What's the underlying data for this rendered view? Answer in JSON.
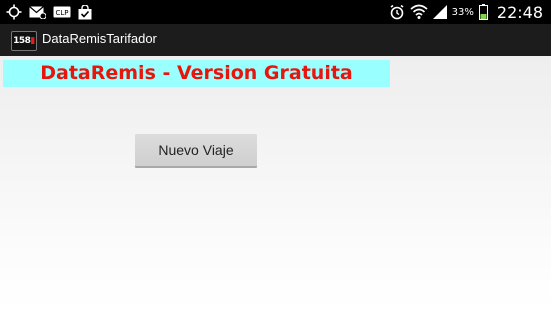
{
  "status_bar": {
    "icons_left": [
      "gps-icon",
      "mail-icon",
      "clip-icon",
      "shopping-bag-icon"
    ],
    "clip_label": "CLP",
    "icons_right": [
      "alarm-icon",
      "wifi-icon",
      "signal-icon",
      "battery-icon"
    ],
    "battery_percent": "33%",
    "time": "22:48"
  },
  "action_bar": {
    "app_icon_text": "158",
    "title": "DataRemisTarifador"
  },
  "banner": {
    "text": "DataRemis - Version Gratuita",
    "background": "#99ffff",
    "color": "#e8150e"
  },
  "main": {
    "new_trip_button": "Nuevo Viaje"
  }
}
